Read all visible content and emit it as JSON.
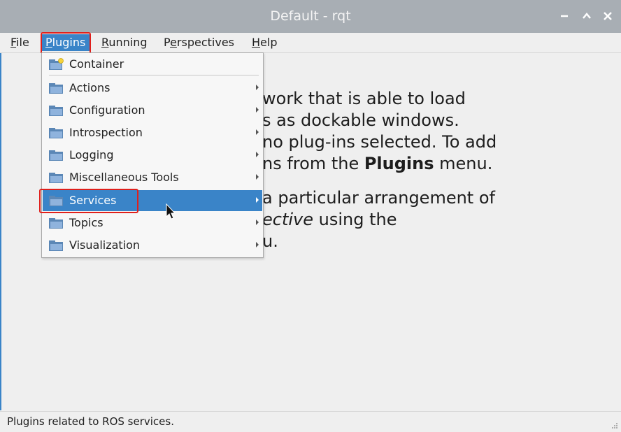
{
  "window": {
    "title": "Default - rqt"
  },
  "menubar": {
    "items": [
      {
        "mnemonic": "F",
        "rest": "ile"
      },
      {
        "mnemonic": "P",
        "rest": "lugins"
      },
      {
        "mnemonic": "R",
        "rest": "unning"
      },
      {
        "pre": "P",
        "mnemonic": "e",
        "rest": "rspectives"
      },
      {
        "mnemonic": "H",
        "rest": "elp"
      }
    ]
  },
  "plugins_menu": {
    "items": [
      {
        "label": "Container",
        "submenu": false
      },
      {
        "label": "Actions",
        "submenu": true
      },
      {
        "label": "Configuration",
        "submenu": true
      },
      {
        "label": "Introspection",
        "submenu": true
      },
      {
        "label": "Logging",
        "submenu": true
      },
      {
        "label": "Miscellaneous Tools",
        "submenu": true
      },
      {
        "label": "Services",
        "submenu": true
      },
      {
        "label": "Topics",
        "submenu": true
      },
      {
        "label": "Visualization",
        "submenu": true
      }
    ]
  },
  "welcome": {
    "p1_lines": [
      "work that is able to load",
      "s as dockable windows.",
      " no plug-ins selected. To add",
      "ns from the "
    ],
    "p1_bold": "Plugins",
    "p1_end": " menu.",
    "p2_line1": "a particular arrangement of",
    "p2_italic": "ective",
    "p2_line2_rest": " using the",
    "p2_line3": "u."
  },
  "status": {
    "text": "Plugins related to ROS services."
  },
  "colors": {
    "accent": "#3a84c8",
    "highlight_box": "#e0201c",
    "titlebar": "#a8aeb4"
  },
  "icons": [
    "folder-icon",
    "folder-new-icon",
    "chevron-right-icon",
    "close-icon",
    "maximize-icon",
    "minimize-icon",
    "mouse-cursor-icon",
    "resize-grip-icon"
  ]
}
